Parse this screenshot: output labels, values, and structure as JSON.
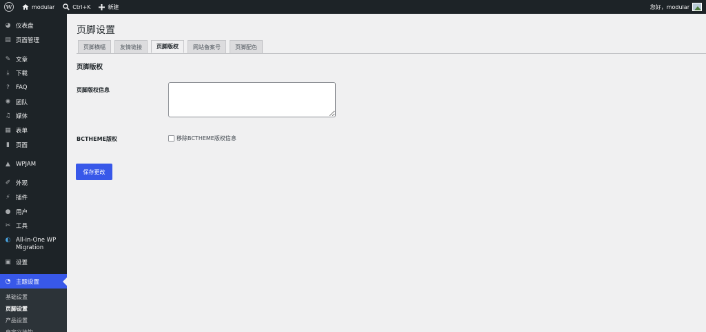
{
  "adminbar": {
    "site_name": "modular",
    "shortcut": "Ctrl+K",
    "new_label": "新建",
    "greeting": "您好，modular"
  },
  "sidebar": {
    "items": [
      {
        "label": "仪表盘",
        "icon": "dashboard-icon"
      },
      {
        "label": "页面管理",
        "icon": "page-manage-icon"
      },
      {
        "label": "文章",
        "icon": "pin-icon"
      },
      {
        "label": "下载",
        "icon": "download-icon"
      },
      {
        "label": "FAQ",
        "icon": "help-icon"
      },
      {
        "label": "团队",
        "icon": "team-icon"
      },
      {
        "label": "媒体",
        "icon": "media-icon"
      },
      {
        "label": "表单",
        "icon": "form-icon"
      },
      {
        "label": "页面",
        "icon": "page-icon"
      },
      {
        "label": "WPJAM",
        "icon": "wpjam-icon"
      },
      {
        "label": "外观",
        "icon": "appearance-icon"
      },
      {
        "label": "插件",
        "icon": "plugin-icon"
      },
      {
        "label": "用户",
        "icon": "user-icon"
      },
      {
        "label": "工具",
        "icon": "tools-icon"
      },
      {
        "label": "All-in-One WP Migration",
        "icon": "migration-icon"
      },
      {
        "label": "设置",
        "icon": "settings-icon"
      },
      {
        "label": "主题设置",
        "icon": "theme-settings-icon"
      }
    ],
    "submenu": [
      "基础设置",
      "页脚设置",
      "产品设置",
      "自定义挂钩"
    ]
  },
  "main": {
    "title": "页脚设置",
    "tabs": [
      "页脚横幅",
      "友情链接",
      "页脚版权",
      "网站备案号",
      "页脚配色"
    ],
    "active_tab": "页脚版权",
    "section_title": "页脚版权",
    "copyright_label": "页脚版权信息",
    "copyright_value": "",
    "bctheme_label": "BCTHEME版权",
    "bctheme_checkbox_label": "移除BCTHEME版权信息",
    "save_label": "保存更改"
  },
  "colors": {
    "accent": "#3858e9",
    "adminbar_bg": "#1d2327",
    "content_bg": "#f0f0f1"
  }
}
